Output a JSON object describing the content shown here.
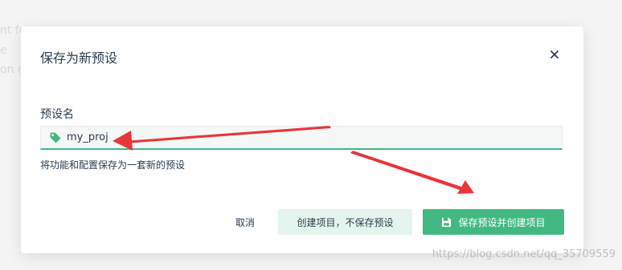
{
  "background": {
    "line1": "nt fo",
    "line2": "e",
    "line3": "on c"
  },
  "dialog": {
    "title": "保存为新预设",
    "close_icon": "close-icon",
    "field_label": "预设名",
    "input_value": "my_proj",
    "tag_icon": "tag-icon",
    "hint": "将功能和配置保存为一套新的预设",
    "cancel_label": "取消",
    "create_without_saving_label": "创建项目，不保存预设",
    "save_and_create_label": "保存预设并创建项目",
    "save_icon": "save-icon"
  },
  "colors": {
    "accent": "#42b983",
    "accent_light": "#e5f5ee",
    "annotation_arrow": "#e8363a"
  },
  "watermark": "https://blog.csdn.net/qq_35709559"
}
